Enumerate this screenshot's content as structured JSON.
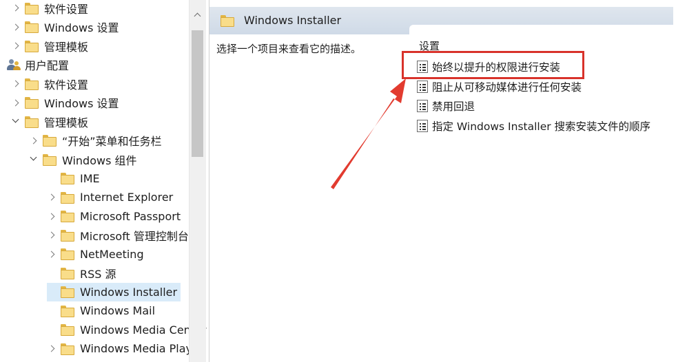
{
  "tree": {
    "items": [
      {
        "label": "软件设置",
        "level": 0,
        "expander": "collapsed",
        "icon": "folder-icon"
      },
      {
        "label": "Windows 设置",
        "level": 0,
        "expander": "collapsed",
        "icon": "folder-icon"
      },
      {
        "label": "管理模板",
        "level": 0,
        "expander": "collapsed",
        "icon": "folder-icon"
      },
      {
        "label": "用户配置",
        "level": -1,
        "expander": "none",
        "icon": "user-config-icon"
      },
      {
        "label": "软件设置",
        "level": 0,
        "expander": "collapsed",
        "icon": "folder-icon"
      },
      {
        "label": "Windows 设置",
        "level": 0,
        "expander": "collapsed",
        "icon": "folder-icon"
      },
      {
        "label": "管理模板",
        "level": 0,
        "expander": "expanded",
        "icon": "folder-icon"
      },
      {
        "label": "“开始”菜单和任务栏",
        "level": 1,
        "expander": "collapsed",
        "icon": "folder-icon"
      },
      {
        "label": "Windows 组件",
        "level": 1,
        "expander": "expanded",
        "icon": "folder-icon"
      },
      {
        "label": "IME",
        "level": 2,
        "expander": "none",
        "icon": "folder-icon"
      },
      {
        "label": "Internet Explorer",
        "level": 2,
        "expander": "collapsed",
        "icon": "folder-icon"
      },
      {
        "label": "Microsoft Passport",
        "level": 2,
        "expander": "collapsed",
        "icon": "folder-icon"
      },
      {
        "label": "Microsoft 管理控制台",
        "level": 2,
        "expander": "collapsed",
        "icon": "folder-icon"
      },
      {
        "label": "NetMeeting",
        "level": 2,
        "expander": "collapsed",
        "icon": "folder-icon"
      },
      {
        "label": "RSS 源",
        "level": 2,
        "expander": "none",
        "icon": "folder-icon"
      },
      {
        "label": "Windows Installer",
        "level": 2,
        "expander": "none",
        "icon": "folder-icon",
        "selected": true
      },
      {
        "label": "Windows Mail",
        "level": 2,
        "expander": "none",
        "icon": "folder-icon"
      },
      {
        "label": "Windows Media Center",
        "level": 2,
        "expander": "none",
        "icon": "folder-icon"
      },
      {
        "label": "Windows Media Player",
        "level": 2,
        "expander": "collapsed",
        "icon": "folder-icon"
      }
    ]
  },
  "header": {
    "title": "Windows Installer",
    "icon": "folder-icon"
  },
  "description": {
    "text": "选择一个项目来查看它的描述。"
  },
  "settings": {
    "column_header": "设置",
    "items": [
      {
        "label": "始终以提升的权限进行安装",
        "icon": "policy-setting-icon",
        "highlighted": true
      },
      {
        "label": "阻止从可移动媒体进行任何安装",
        "icon": "policy-setting-icon"
      },
      {
        "label": "禁用回退",
        "icon": "policy-setting-icon"
      },
      {
        "label": "指定 Windows Installer 搜索安装文件的顺序",
        "icon": "policy-setting-icon"
      }
    ]
  },
  "annotation": {
    "highlight_color": "#d8322a",
    "arrow_color": "#e23b2f"
  },
  "colors": {
    "selection": "#d9ebf9",
    "header_bar": "#d5dfea"
  }
}
